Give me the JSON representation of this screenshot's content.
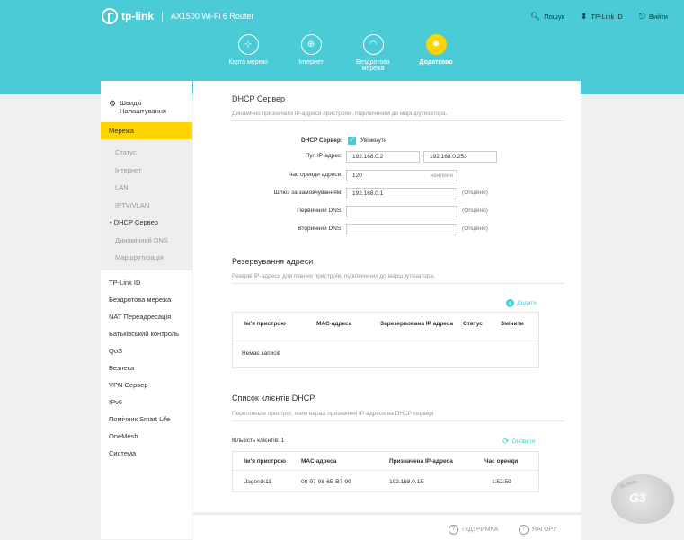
{
  "header": {
    "brand": "tp-link",
    "model": "AX1500 Wi-Fi 6 Router",
    "tools": {
      "search": "Пошук",
      "tplink_id": "TP-Link ID",
      "exit": "Вийти"
    },
    "nav": [
      {
        "label": "Карта мережі",
        "icon": "network-map-icon"
      },
      {
        "label": "Інтернет",
        "icon": "globe-icon"
      },
      {
        "label": "Бездротова мережа",
        "icon": "wifi-icon"
      },
      {
        "label": "Додатково",
        "icon": "gear-icon"
      }
    ],
    "active_tab": "Додатково",
    "colors": {
      "band": "#4acbd6",
      "accent": "#ffd400"
    }
  },
  "sidebar": {
    "quick_setup": "Швидкі Налаштування",
    "network": "Мережа",
    "sub": [
      "Статус",
      "Інтернет",
      "LAN",
      "IPTV/VLAN",
      "DHCP Сервер",
      "Динамічний DNS",
      "Маршрутизація"
    ],
    "items": [
      "TP-Link ID",
      "Бездротова мережа",
      "NAT Переадресація",
      "Батьківський контроль",
      "QoS",
      "Безпека",
      "VPN Сервер",
      "IPv6",
      "Помічник Smart Life",
      "OneMesh",
      "Система"
    ]
  },
  "dhcp": {
    "title": "DHCP Сервер",
    "desc": "Динамічно призначати IP-адреси пристроям, підключеним до маршрутизатора.",
    "server_label": "DHCP Сервер:",
    "server_state": "Увімкнути",
    "pool_label": "Пул IP-адрес:",
    "pool_start": "192.168.0.2",
    "pool_dash": "-",
    "pool_end": "192.168.0.253",
    "lease_label": "Час оренди адреси:",
    "lease_value": "120",
    "lease_unit": "хвилини",
    "gateway_label": "Шлюз за замовчуванням:",
    "gateway_value": "192.168.0.1",
    "optional": "(Опційно)",
    "dns1_label": "Первинний DNS:",
    "dns2_label": "Вторинний DNS:"
  },
  "reservation": {
    "title": "Резервування адреси",
    "desc": "Резерві IP-адреси для певних пристроїв, підключених до маршрутизатора.",
    "add": "Додати",
    "columns": [
      "Ім'я пристрою",
      "МАС-адреса",
      "Зарезервована IP адреса",
      "Статус",
      "Змінити"
    ],
    "empty": "Немає записів"
  },
  "clients": {
    "title": "Список клієнтів DHCP",
    "desc": "Перегляньте пристрої, яким наразі призначені IP-адреси на DHCP сервері.",
    "count_label": "Кількість клієнтів: 1",
    "refresh": "Оновити",
    "columns": [
      "Ім'я пристрою",
      "МАС-адреса",
      "Призначена IP-адреса",
      "Час оренди"
    ],
    "rows": [
      {
        "name": "Jagerok11",
        "mac": "08-97-98-6E-B7-99",
        "ip": "192.168.0.15",
        "lease": "1:52:59"
      }
    ]
  },
  "footer": {
    "support": "ПІДТРИМКА",
    "top": "НАГОРУ"
  }
}
